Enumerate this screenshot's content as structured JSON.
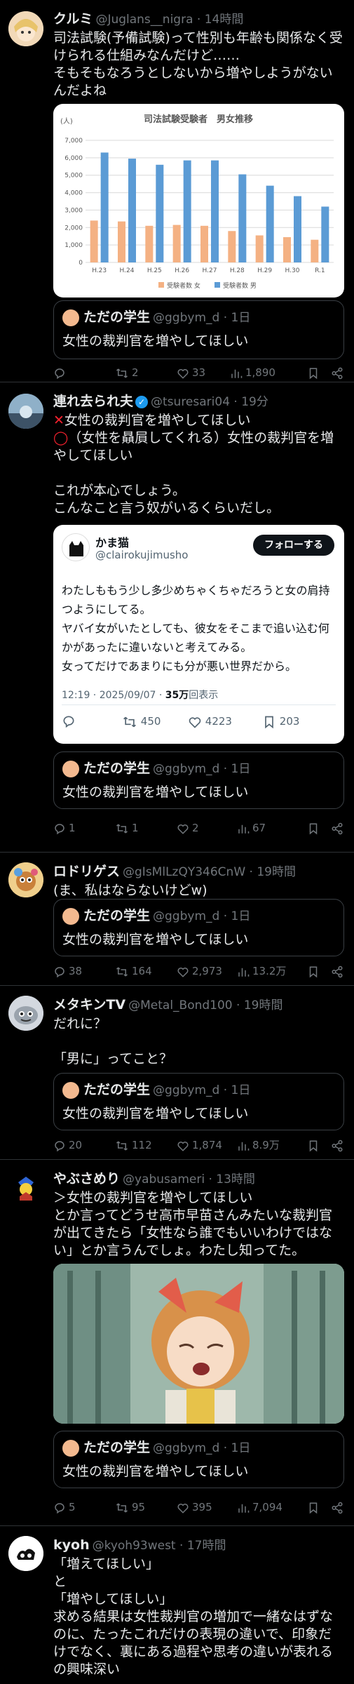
{
  "tweets": [
    {
      "name": "クルミ",
      "handle": "@Juglans__nigra · 14時間",
      "text": "司法試験(予備試験)って性別も年齢も関係なく受けられる仕組みなんだけど……\nそもそもなろうとしないから増やしようがないんだよね",
      "quote": {
        "name": "ただの学生",
        "handle": "@ggbym_d · 1日",
        "text": "女性の裁判官を増やしてほしい"
      },
      "actions": {
        "reply": "",
        "retweet": "2",
        "like": "33",
        "views": "1,890"
      }
    },
    {
      "name": "連れ去られ夫",
      "handle": "@tsuresari04 · 19分",
      "line1": "女性の裁判官を増やしてほしい",
      "line2": "（女性を贔屓してくれる）女性の裁判官を増やしてほしい",
      "line3": "これが本心でしょう。\nこんなこと言う奴がいるくらいだし。",
      "quote": {
        "name": "ただの学生",
        "handle": "@ggbym_d · 1日",
        "text": "女性の裁判官を増やしてほしい"
      },
      "actions": {
        "reply": "1",
        "retweet": "1",
        "like": "2",
        "views": "67"
      }
    },
    {
      "name": "ロドリゲス",
      "handle": "@gIsMlLzQY346CnW · 19時間",
      "text": "(ま、私はならないけどw)",
      "quote": {
        "name": "ただの学生",
        "handle": "@ggbym_d · 1日",
        "text": "女性の裁判官を増やしてほしい"
      },
      "actions": {
        "reply": "38",
        "retweet": "164",
        "like": "2,973",
        "views": "13.2万"
      }
    },
    {
      "name": "メタキンTV",
      "handle": "@Metal_Bond100 · 19時間",
      "text": "だれに？\n\n「男に」ってこと？",
      "quote": {
        "name": "ただの学生",
        "handle": "@ggbym_d · 1日",
        "text": "女性の裁判官を増やしてほしい"
      },
      "actions": {
        "reply": "20",
        "retweet": "112",
        "like": "1,874",
        "views": "8.9万"
      }
    },
    {
      "name": "やぶさめり",
      "handle": "@yabusameri · 13時間",
      "text": "＞女性の裁判官を増やしてほしい\nとか言ってどうせ高市早苗さんみたいな裁判官が出てきたら「女性なら誰でもいいわけではない」とか言うんでしょ。わたし知ってた。",
      "quote": {
        "name": "ただの学生",
        "handle": "@ggbym_d · 1日",
        "text": "女性の裁判官を増やしてほしい"
      },
      "actions": {
        "reply": "5",
        "retweet": "95",
        "like": "395",
        "views": "7,094"
      }
    },
    {
      "name": "kyoh",
      "handle": "@kyoh93west · 17時間",
      "text": "「増えてほしい」\nと\n「増やしてほしい」\n求める結果は女性裁判官の増加で一緒なはずなのに、たったこれだけの表現の違いで、印象だけでなく、裏にある過程や思考の違いが表れるの興味深い"
    }
  ],
  "embedded": {
    "name": "かま猫",
    "handle": "@clairokujimusho",
    "follow": "フォローする",
    "text": "わたしももう少し多少めちゃくちゃだろうと女の肩持つようにしてる。\nヤバイ女がいたとしても、彼女をそこまで追い込む何かがあったに違いないと考えてみる。\n女ってだけであまりにも分が悪い世界だから。",
    "meta_prefix": "12:19 · 2025/09/07 · ",
    "meta_views": "35万",
    "meta_suffix": "回表示",
    "retweets": "450",
    "likes": "4223",
    "bookmarks": "203"
  },
  "chart_data": {
    "type": "bar",
    "title": "司法試験受験者　男女推移",
    "unit_label": "(人)",
    "categories": [
      "H.23",
      "H.24",
      "H.25",
      "H.26",
      "H.27",
      "H.28",
      "H.29",
      "H.30",
      "R.1"
    ],
    "series": [
      {
        "name": "受験者数 女",
        "color": "#f4b183",
        "values": [
          2400,
          2350,
          2100,
          2150,
          2100,
          1800,
          1550,
          1450,
          1300
        ]
      },
      {
        "name": "受験者数 男",
        "color": "#5b9bd5",
        "values": [
          6300,
          5950,
          5600,
          5850,
          5850,
          5050,
          4400,
          3800,
          3200
        ]
      }
    ],
    "yticks": [
      "0",
      "1,000",
      "2,000",
      "3,000",
      "4,000",
      "5,000",
      "6,000",
      "7,000"
    ],
    "ylim": [
      0,
      7000
    ],
    "legend": "bottom"
  },
  "colors": {
    "accent": "#1d9bf0",
    "like": "#f91880",
    "red_mark": "#f4212e",
    "muted": "#71767b"
  }
}
